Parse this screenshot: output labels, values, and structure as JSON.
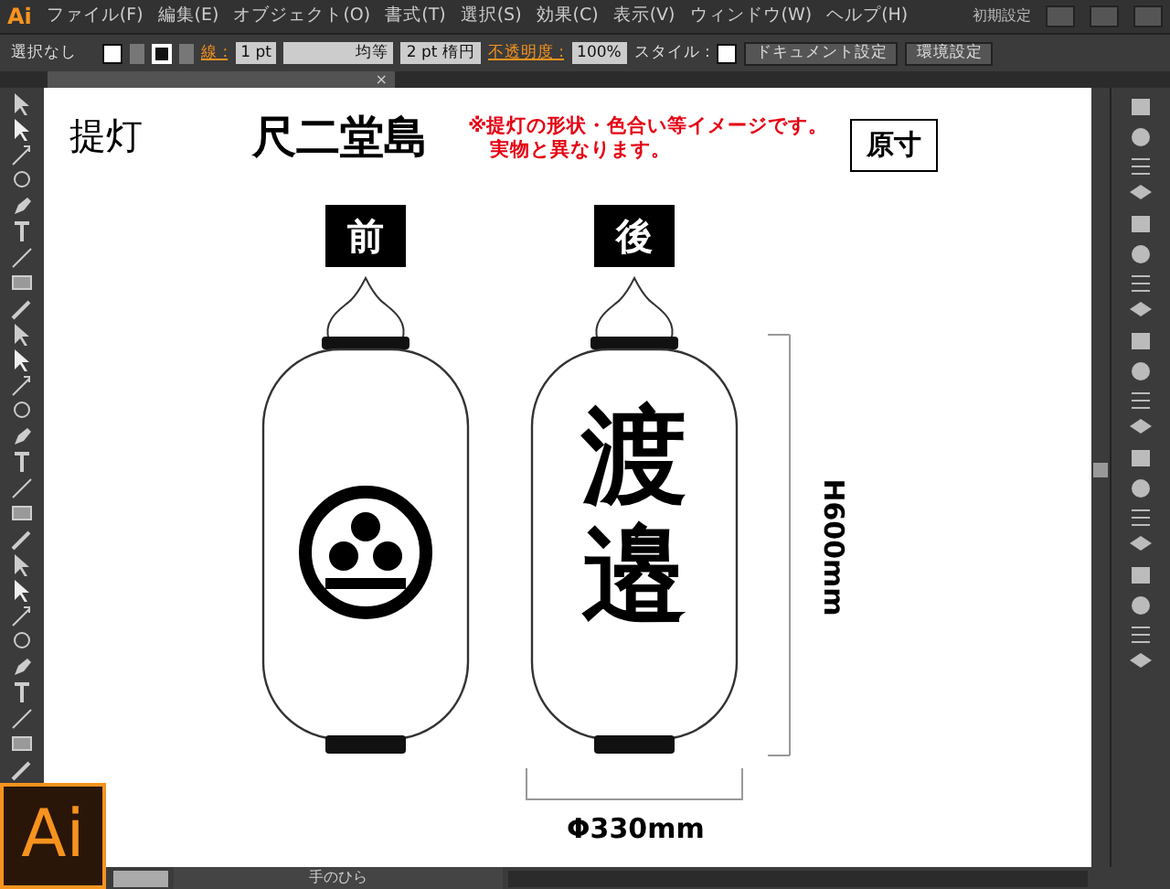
{
  "menubar": {
    "logo": "Ai",
    "items": [
      "ファイル(F)",
      "編集(E)",
      "オブジェクト(O)",
      "書式(T)",
      "選択(S)",
      "効果(C)",
      "表示(V)",
      "ウィンドウ(W)",
      "ヘルプ(H)"
    ],
    "workspace": "初期設定"
  },
  "control_bar": {
    "selection": "選択なし",
    "stroke_label": "線 :",
    "stroke_weight": "1 pt",
    "stroke_profile": "均等",
    "brush": "2 pt 楕円",
    "opacity_label": "不透明度 :",
    "opacity": "100%",
    "style_label": "スタイル :",
    "buttons": [
      "ドキュメント設定",
      "環境設定"
    ]
  },
  "document_tab": {
    "close": "×"
  },
  "artboard": {
    "title": "提灯",
    "name": "尺二堂島",
    "note_lines": [
      "※提灯の形状・色合い等イメージです。",
      "実物と異なります。"
    ],
    "scale_badge": "原寸",
    "lanterns": [
      {
        "label": "前",
        "kind": "crest"
      },
      {
        "label": "後",
        "kind": "text",
        "text": "渡邉"
      }
    ],
    "height_dimension": "H600mm",
    "width_dimension": "Φ330mm"
  },
  "status_bar": {
    "tool": "手のひら"
  },
  "corner_logo": "Ai"
}
